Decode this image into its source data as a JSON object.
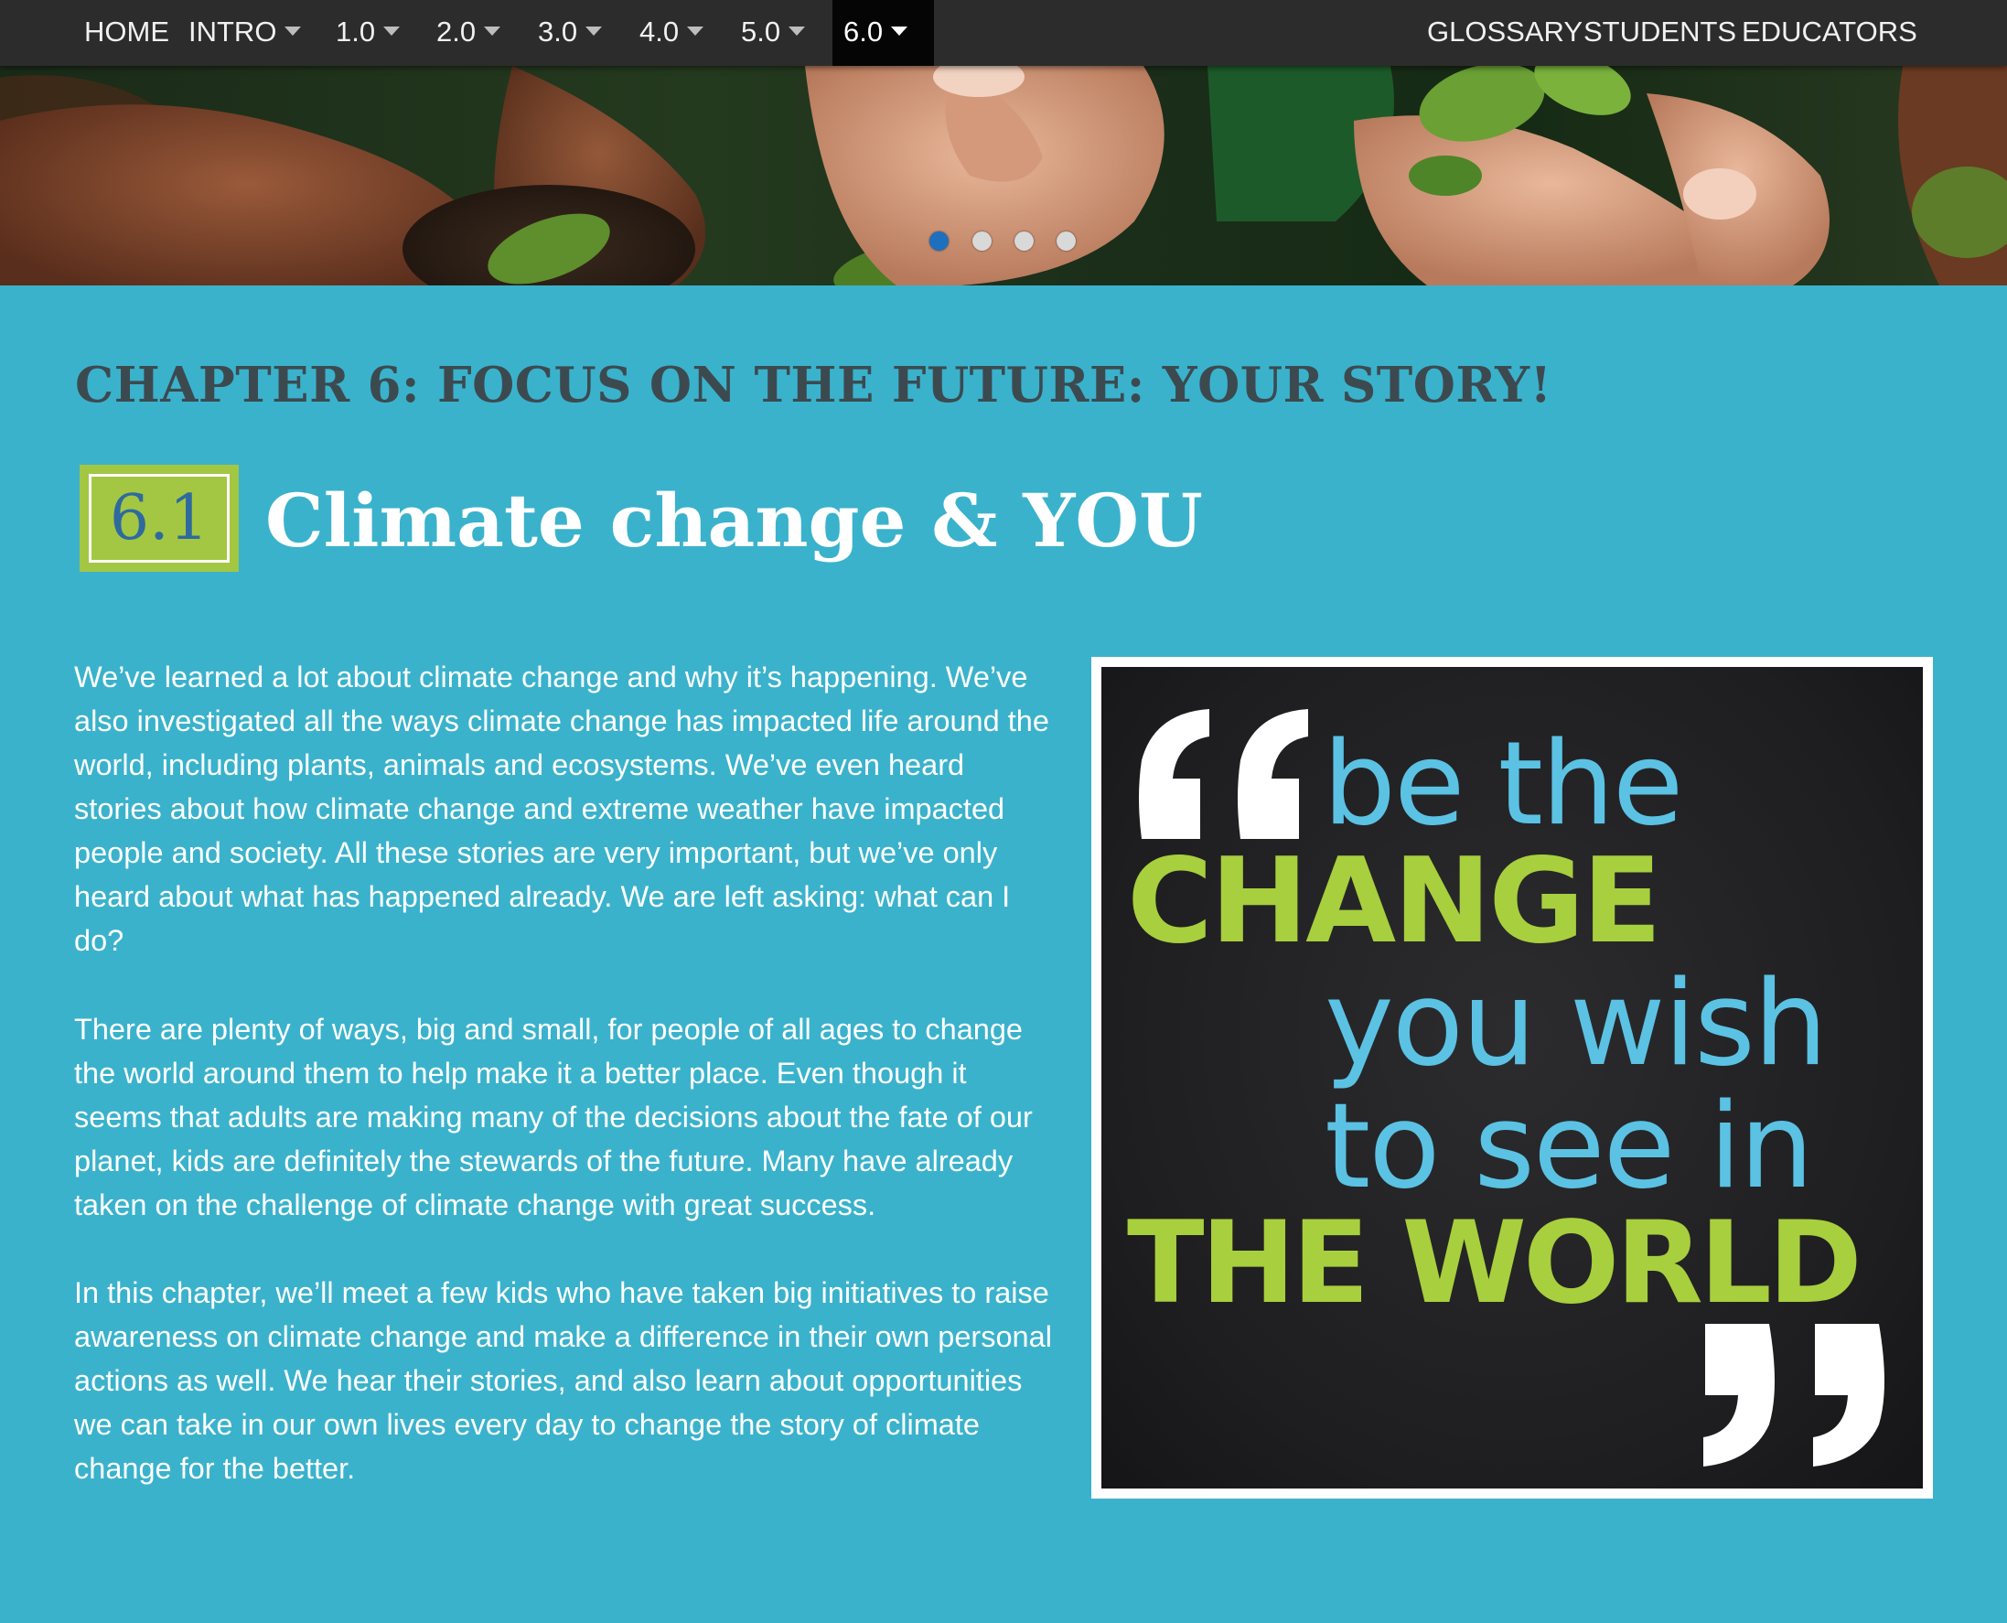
{
  "nav": {
    "left_items": [
      {
        "label": "HOME",
        "dropdown": false
      },
      {
        "label": "INTRO",
        "dropdown": true
      },
      {
        "label": "1.0",
        "dropdown": true
      },
      {
        "label": "2.0",
        "dropdown": true
      },
      {
        "label": "3.0",
        "dropdown": true
      },
      {
        "label": "4.0",
        "dropdown": true
      },
      {
        "label": "5.0",
        "dropdown": true
      },
      {
        "label": "6.0",
        "dropdown": true,
        "active": true
      }
    ],
    "right_items": [
      {
        "label": "GLOSSARY"
      },
      {
        "label": "STUDENTS"
      },
      {
        "label": "EDUCATORS"
      }
    ]
  },
  "hero": {
    "slide_count": 4,
    "active_slide": 1
  },
  "content": {
    "chapter_title": "CHAPTER 6: FOCUS ON THE FUTURE: YOUR STORY!",
    "section_number": "6.1",
    "section_title": "Climate change & YOU",
    "paragraphs": [
      "We’ve learned a lot about climate change and why it’s happening. We’ve also investigated all the ways climate change has impacted life around the world, including plants, animals and ecosystems. We’ve even heard stories about how climate change and extreme weather have impacted people and society. All these stories are very important, but we’ve only heard about what has happened already. We are left asking: what can I do?",
      "There are plenty of ways, big and small, for people of all ages to change the world around them to help make it a better place. Even though it seems that adults are making many of the decisions about the fate of our planet, kids are definitely the stewards of the future. Many have already taken on the challenge of climate change with great success.",
      "In this chapter, we’ll meet a few kids who have taken big initiatives to raise awareness on climate change and make a difference in their own personal actions as well. We hear their stories, and also learn about opportunities we can take in our own lives every day to change the story of climate change for the better."
    ]
  },
  "quote_image": {
    "line1": "be the",
    "line2": "CHANGE",
    "line3": "you wish",
    "line4": "to see in",
    "line5": "THE WORLD",
    "open_quote_icon": "open-quote-marks",
    "close_quote_icon": "close-quote-marks",
    "colors": {
      "light_text": "#5bc2e4",
      "bold_text": "#a8cf3d",
      "quote_marks": "#ffffff",
      "background": "#1e1e20"
    }
  },
  "colors": {
    "page_background": "#3ab2cc",
    "navbar_background": "#2c2c2c",
    "nav_active_background": "#050505",
    "badge_background": "#a3c742",
    "badge_number": "#2e6a9e",
    "chapter_title": "#3c4a50"
  }
}
